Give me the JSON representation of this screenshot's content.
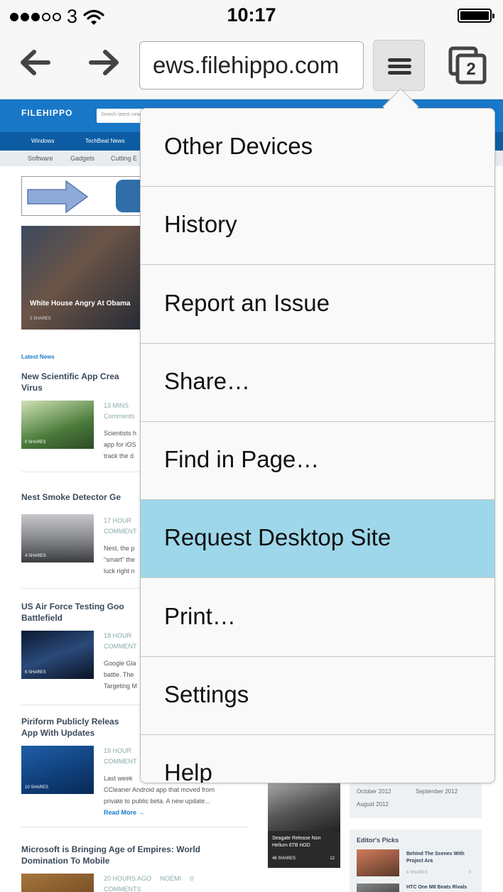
{
  "status_bar": {
    "carrier": "3",
    "time": "10:17"
  },
  "toolbar": {
    "url": "ews.filehippo.com",
    "tab_count": "2",
    "icons": {
      "back": "back-arrow-icon",
      "forward": "forward-arrow-icon",
      "menu": "hamburger-icon",
      "tabs": "tabs-icon"
    }
  },
  "page": {
    "logo_text": "FILEHIPPO",
    "search_placeholder": "Search latest news",
    "nav": [
      "Windows",
      "TechBeat News"
    ],
    "subnav": [
      "Software",
      "Gadgets",
      "Cutting E"
    ],
    "hero": {
      "title": "White House Angry At Obama",
      "shares": "2 SHARES"
    },
    "latest_label": "Latest News",
    "articles": [
      {
        "title": "New Scientific App Crea",
        "title2": "Virus",
        "meta1": "13 MINS",
        "meta2": "Comments",
        "shares": "0 SHARES",
        "body": [
          "Scientists h",
          "app for iOS",
          "track the d"
        ]
      },
      {
        "title": "Nest Smoke Detector Ge",
        "title2": "",
        "meta1": "17 HOUR",
        "meta2": "COMMENT",
        "shares": "4 SHARES",
        "body": [
          "Nest, the p",
          "\"smart\" the",
          "luck right n"
        ]
      },
      {
        "title": "US Air Force Testing Goo",
        "title2": "Battlefield",
        "meta1": "18 HOUR",
        "meta2": "COMMENT",
        "shares": "6 SHARES",
        "body": [
          "Google Gla",
          "battle. The",
          "Targeting M"
        ]
      },
      {
        "title": "Piriform Publicly Releas",
        "title2": "App With Updates",
        "meta1": "19 HOUR",
        "meta2": "COMMENT",
        "shares": "10 SHARES",
        "body": [
          "Last week",
          "CCleaner Android app that moved from",
          "private to public beta. A new update..."
        ],
        "read_more": "Read More →"
      },
      {
        "title": "Microsoft is Bringing Age of Empires: World",
        "title2": "Domination To Mobile",
        "meta1": "20 HOURS AGO",
        "author": "NOEMI",
        "meta_count": "0",
        "meta2": "COMMENTS"
      }
    ],
    "sidebar": {
      "archive": [
        "October 2012",
        "September 2012",
        "August 2012"
      ],
      "card": {
        "title": "Seagate Release Non Helium 6TB HDD",
        "shares": "46 SHARES",
        "comments": "12"
      },
      "editors_picks": "Editor's Picks",
      "picks": [
        {
          "title": "Behind The Scenes With Project Ara",
          "shares": "6 SHARES",
          "comments": "0"
        },
        {
          "title": "HTC One M8 Beats Rivals",
          "shares": "",
          "comments": ""
        }
      ]
    }
  },
  "menu": {
    "items": [
      {
        "label": "Other Devices",
        "selected": false
      },
      {
        "label": "History",
        "selected": false
      },
      {
        "label": "Report an Issue",
        "selected": false
      },
      {
        "label": "Share…",
        "selected": false
      },
      {
        "label": "Find in Page…",
        "selected": false
      },
      {
        "label": "Request Desktop Site",
        "selected": true
      },
      {
        "label": "Print…",
        "selected": false
      },
      {
        "label": "Settings",
        "selected": false
      },
      {
        "label": "Help",
        "selected": false
      }
    ],
    "highlight_color": "#9ed7ea"
  }
}
